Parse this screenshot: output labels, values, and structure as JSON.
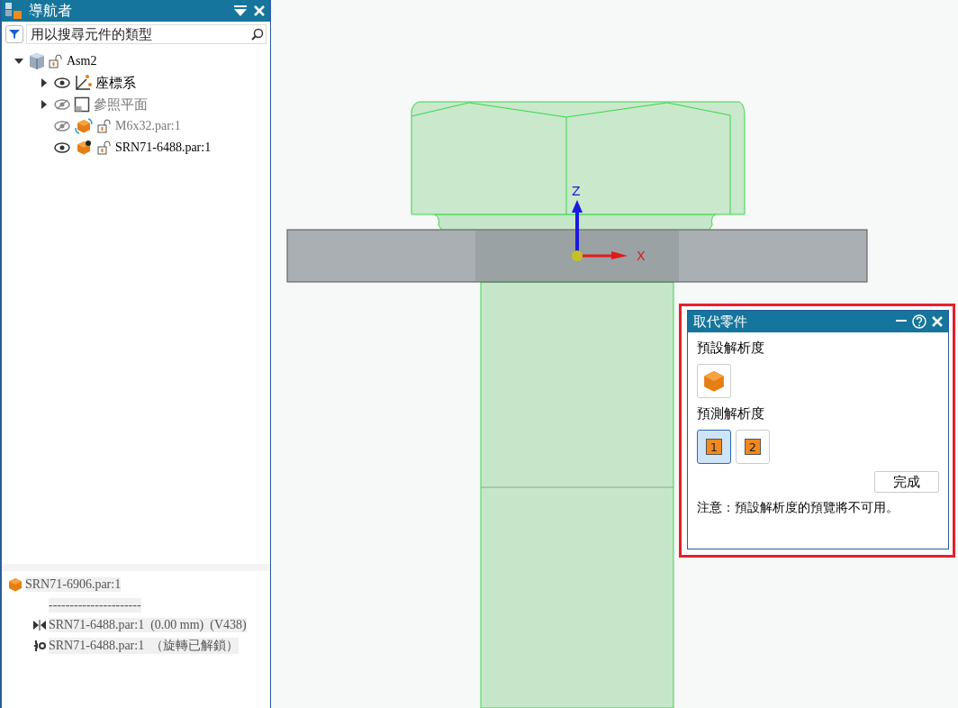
{
  "navigator": {
    "title": "導航者",
    "search": {
      "placeholder": "用以搜尋元件的類型"
    },
    "tree": [
      {
        "label": "Asm2",
        "kind": "assembly",
        "expanded": true,
        "children": [
          {
            "label": "座標系",
            "kind": "coords",
            "expanded": false,
            "visible": true
          },
          {
            "label": "參照平面",
            "kind": "planes",
            "expanded": false,
            "visible": false
          },
          {
            "label": "M6x32.par:1",
            "kind": "part",
            "visible": false
          },
          {
            "label": "SRN71-6488.par:1",
            "kind": "part-active",
            "visible": true
          }
        ]
      }
    ],
    "detail": {
      "part": "SRN71-6906.par:1",
      "separator": "----------------------",
      "relations": [
        {
          "kind": "mate",
          "text": "SRN71-6488.par:1  (0.00 mm)  (V438)"
        },
        {
          "kind": "axial",
          "text": "SRN71-6488.par:1  （旋轉已解鎖）"
        }
      ]
    }
  },
  "viewport": {
    "triad": {
      "z_label": "Z",
      "x_label": "X"
    }
  },
  "dialog": {
    "title": "取代零件",
    "default_label": "預設解析度",
    "predict_label": "預測解析度",
    "options": [
      {
        "label": "1",
        "selected": true
      },
      {
        "label": "2",
        "selected": false
      }
    ],
    "done": "完成",
    "note": "注意：預設解析度的預覽將不可用。"
  }
}
